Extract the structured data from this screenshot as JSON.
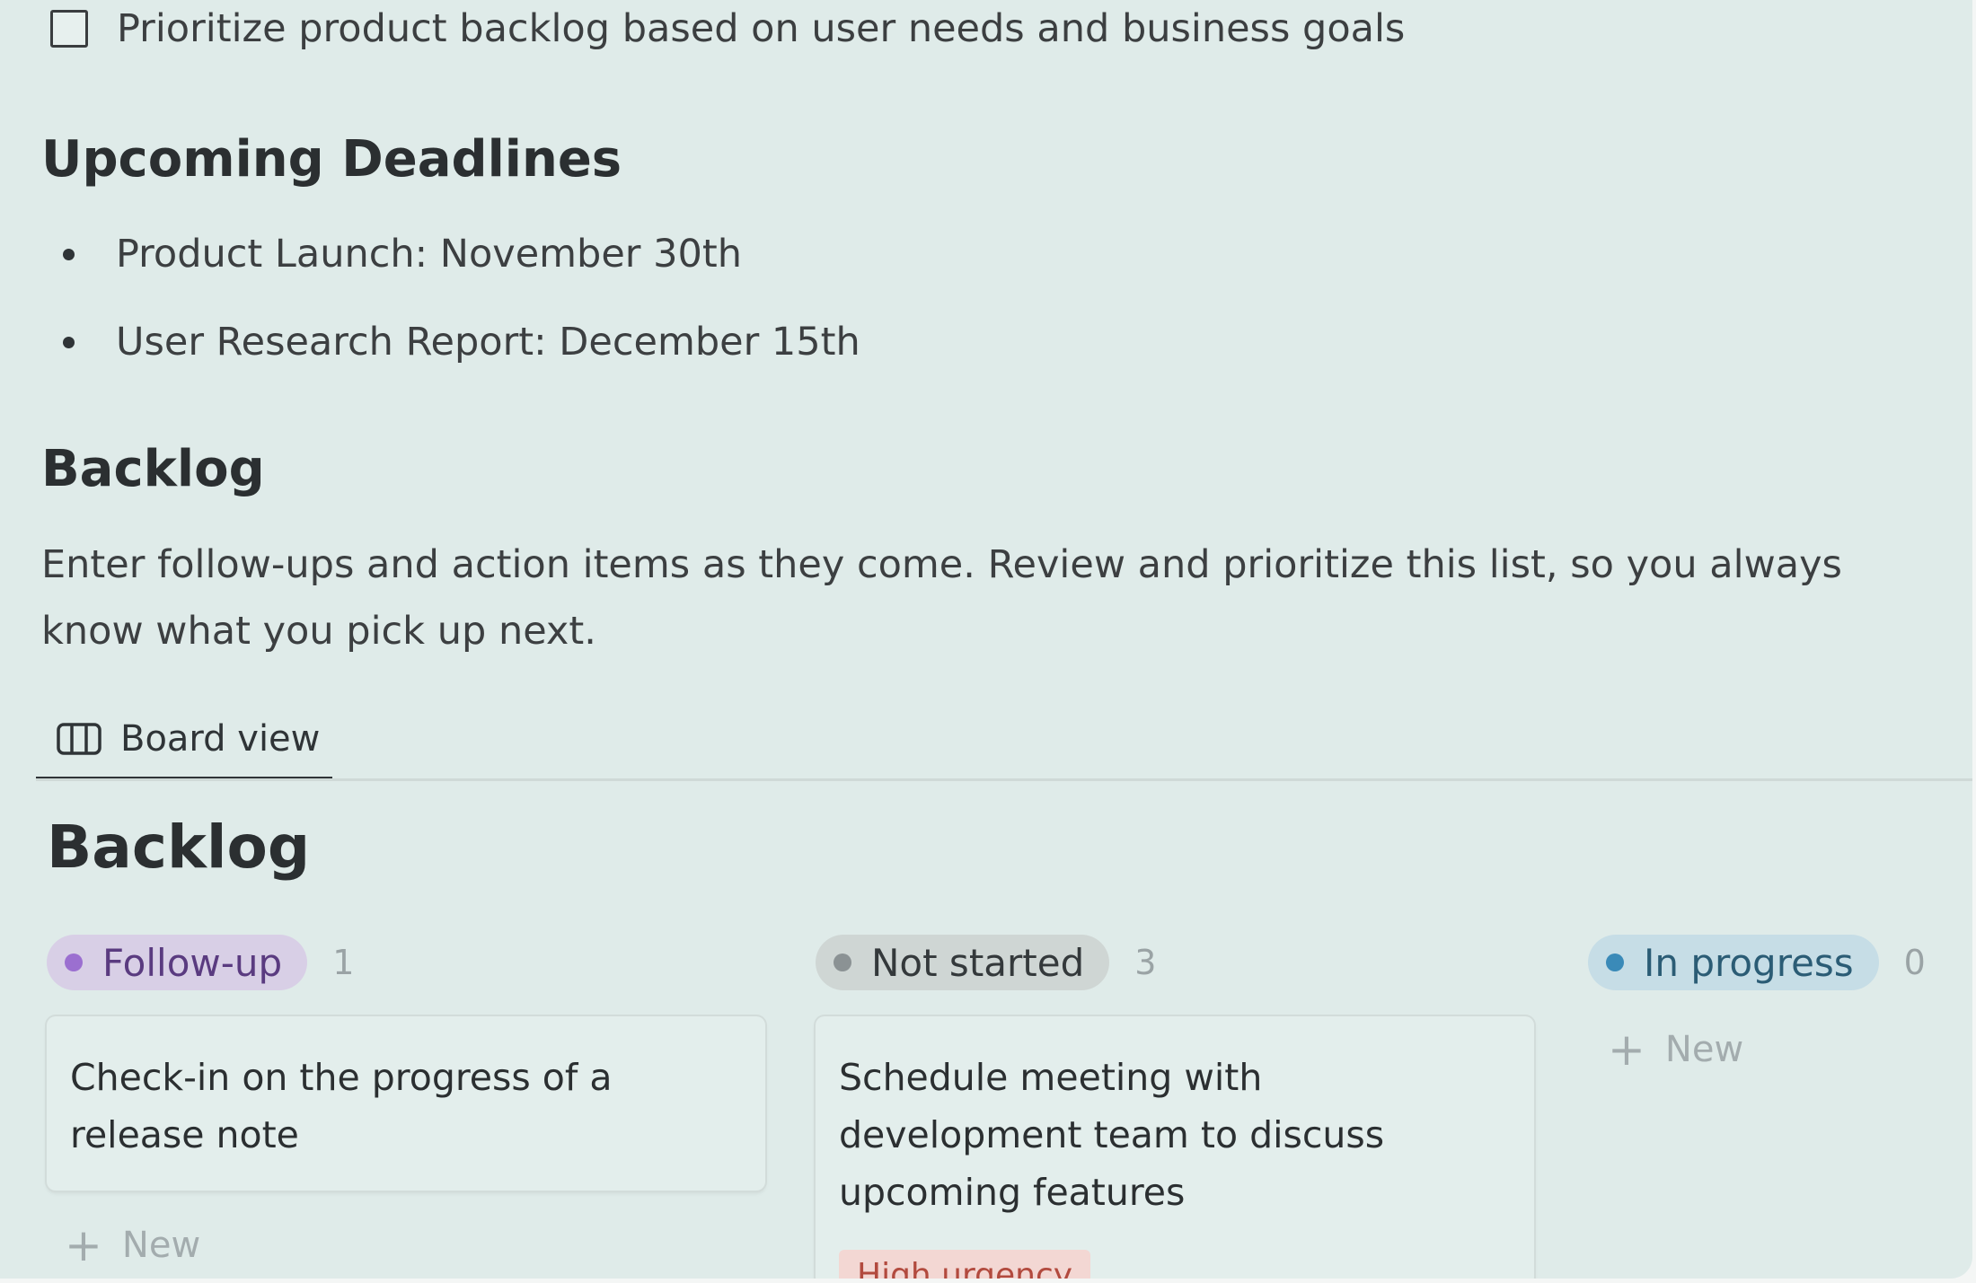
{
  "todo": {
    "text": "Prioritize product backlog based on user needs and business goals",
    "checked": false
  },
  "deadlines": {
    "heading": "Upcoming Deadlines",
    "items": [
      "Product Launch: November 30th",
      "User Research Report: December 15th"
    ]
  },
  "backlog_section": {
    "heading": "Backlog",
    "description": "Enter follow-ups and action items as they come. Review and prioritize this list, so you always know what you pick up next."
  },
  "view": {
    "tab_label": "Board view",
    "icon": "board-view-icon"
  },
  "board": {
    "title": "Backlog",
    "columns": [
      {
        "status": "Follow-up",
        "count": "1",
        "pill_bg": "#d8cfe6",
        "pill_text": "#5a3b80",
        "dot": "#9b6fd0",
        "cards": [
          {
            "title": "Check-in on the progress of a release note"
          }
        ],
        "new_label": "New"
      },
      {
        "status": "Not started",
        "count": "3",
        "pill_bg": "#cfd6d4",
        "pill_text": "#34393b",
        "dot": "#8b9294",
        "cards": [
          {
            "title": "Schedule meeting with development team to discuss upcoming features",
            "tag": "High urgency"
          }
        ]
      },
      {
        "status": "In progress",
        "count": "0",
        "pill_bg": "#c6dde6",
        "pill_text": "#2b5c75",
        "dot": "#3a8ab8",
        "cards": [],
        "new_label": "New"
      }
    ]
  },
  "colors": {
    "background": "#dfebe9",
    "tag_bg": "#f3d7d3",
    "tag_text": "#b24a3e"
  }
}
